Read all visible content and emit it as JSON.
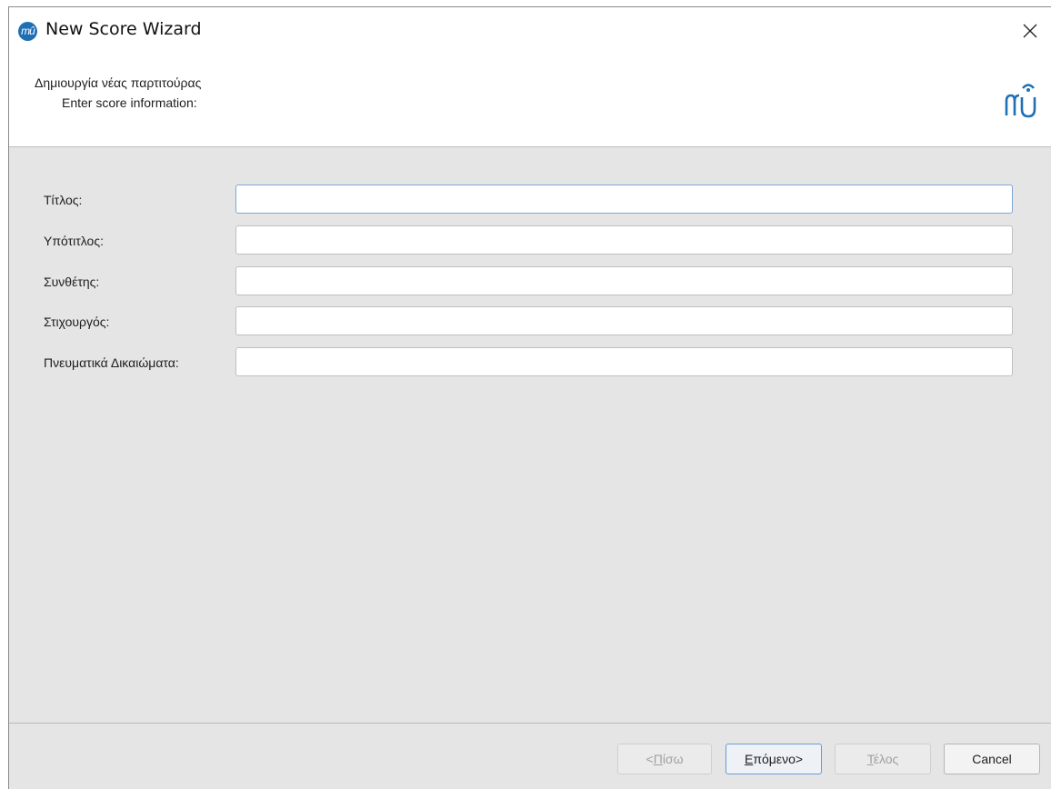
{
  "window": {
    "title": "New Score Wizard",
    "app_icon": "musescore-logo-icon",
    "close_icon": "close-icon"
  },
  "header": {
    "title": "Δημιουργία νέας παρτιτούρας",
    "subtitle": "Enter score information:",
    "logo": "musescore-logo-icon"
  },
  "fields": [
    {
      "label": "Τίτλος:",
      "value": ""
    },
    {
      "label": "Υπότιτλος:",
      "value": ""
    },
    {
      "label": "Συνθέτης:",
      "value": ""
    },
    {
      "label": "Στιχουργός:",
      "value": ""
    },
    {
      "label": "Πνευματικά Δικαιώματα:",
      "value": ""
    }
  ],
  "buttons": {
    "back": {
      "prefix": "<",
      "mnemonic": "Π",
      "rest": "ίσω",
      "disabled": true
    },
    "next": {
      "prefix": "",
      "mnemonic": "Ε",
      "rest": "πόμενο>",
      "disabled": false
    },
    "finish": {
      "prefix": "",
      "mnemonic": "Τ",
      "rest": "έλος",
      "disabled": true
    },
    "cancel": {
      "label": "Cancel"
    }
  },
  "colors": {
    "accent": "#1f6fb5",
    "panel_bg": "#e5e5e5",
    "focus_border": "#7fa8d6"
  }
}
